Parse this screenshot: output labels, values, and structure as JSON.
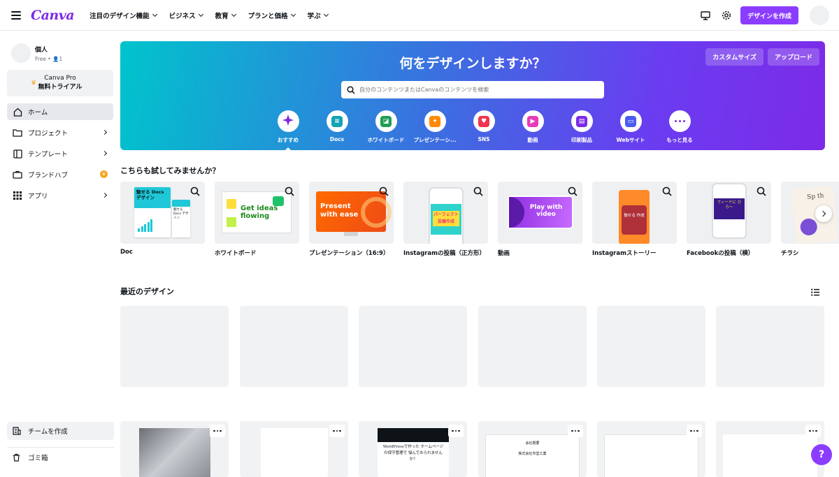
{
  "topbar": {
    "logo": "Canva",
    "nav": [
      "注目のデザイン機能",
      "ビジネス",
      "教育",
      "プランと価格",
      "学ぶ"
    ],
    "create_button": "デザインを作成"
  },
  "sidebar": {
    "account_name": "個人",
    "account_sub": "Free • 👤1",
    "pro_line1": "Canva Pro",
    "pro_line2": "無料トライアル",
    "items": [
      {
        "label": "ホーム"
      },
      {
        "label": "プロジェクト"
      },
      {
        "label": "テンプレート"
      },
      {
        "label": "ブランドハブ"
      },
      {
        "label": "アプリ"
      }
    ],
    "team": "チームを作成",
    "trash": "ゴミ箱"
  },
  "hero": {
    "title": "何をデザインしますか？",
    "custom_size": "カスタムサイズ",
    "upload": "アップロード",
    "search_placeholder": "自分のコンテンツまたはCanvaのコンテンツを検索",
    "categories": [
      "おすすめ",
      "Docs",
      "ホワイトボード",
      "プレゼンテーシ...",
      "SNS",
      "動画",
      "印刷製品",
      "Webサイト",
      "もっと見る"
    ]
  },
  "suggest": {
    "title": "こちらも試してみませんか？",
    "templates": [
      {
        "label": "Doc",
        "thumb_title": "魅せる Docs デザイン",
        "thumb_small": "魅せる Docs デザイン"
      },
      {
        "label": "ホワイトボード",
        "thumb_title": "Get ideas flowing"
      },
      {
        "label": "プレゼンテーション（16:9）",
        "thumb_title": "Present with ease"
      },
      {
        "label": "Instagramの投稿（正方形）",
        "thumb_title": "パーフェクト 投稿作成"
      },
      {
        "label": "動画",
        "thumb_title": "Play with video"
      },
      {
        "label": "Instagramストーリー",
        "thumb_title": "魅せる 作成"
      },
      {
        "label": "Facebookの投稿（横）",
        "thumb_title": "フィードに ひら〜"
      },
      {
        "label": "チラシ",
        "thumb_title": "Sp th"
      }
    ]
  },
  "recent": {
    "title": "最近のデザイン",
    "doc_text_1": "WordPressで作った ホームページの保守管理で 悩んでおられませんか？",
    "doc_text_2a": "会社概要",
    "doc_text_2b": "株式会社市堂工業"
  },
  "help_label": "?",
  "colors": {
    "brand": "#7d2ae8",
    "accent": "#8b3dff"
  }
}
